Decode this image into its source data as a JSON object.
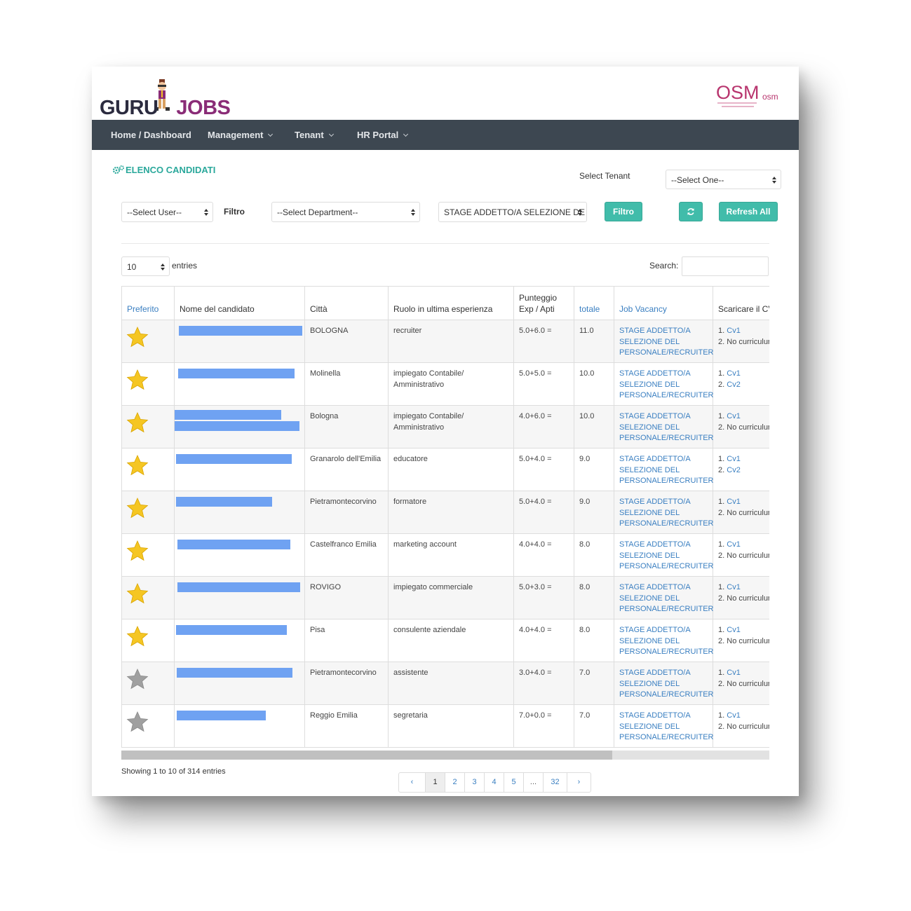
{
  "brand": {
    "logo_left_part": "GURU",
    "logo_right_part": "JOBS",
    "partner_logo": "OSM",
    "partner_logo_small": "osm"
  },
  "nav": {
    "items": [
      {
        "label": "Home / Dashboard",
        "has_caret": false
      },
      {
        "label": "Management",
        "has_caret": true
      },
      {
        "label": "Tenant",
        "has_caret": true
      },
      {
        "label": "HR Portal",
        "has_caret": true
      }
    ]
  },
  "page": {
    "title": "ELENCO CANDIDATI",
    "title_icon": "gears-icon"
  },
  "tenant": {
    "label": "Select Tenant",
    "value": "--Select One--"
  },
  "filters": {
    "user_select": "--Select User--",
    "filter_label": "Filtro",
    "department_select": "--Select Department--",
    "vacancy_select": "STAGE ADDETTO/A SELEZIONE DE",
    "filter_button": "Filtro",
    "reload_icon": "refresh-icon",
    "refresh_all_button": "Refresh All"
  },
  "length": {
    "value": "10",
    "suffix": "entries"
  },
  "search": {
    "label": "Search:",
    "value": ""
  },
  "colors": {
    "accent": "#41bcaa",
    "nav": "#3d4751",
    "link": "#3a7fc1",
    "title": "#2aa89b",
    "star_on": "#f5c623",
    "star_off": "#a0a0a0"
  },
  "table": {
    "headers": {
      "preferito": "Preferito",
      "nome": "Nome del candidato",
      "citta": "Città",
      "ruolo": "Ruolo in ultima esperienza",
      "punteggio_1": "Punteggio",
      "punteggio_2": "Exp / Apti",
      "totale": "totale",
      "job": "Job Vacancy",
      "scaricare": "Scaricare il CV"
    },
    "rows": [
      {
        "favorite": true,
        "city": "BOLOGNA",
        "role": "recruiter",
        "score": "5.0+6.0 =",
        "total": "11.0",
        "job_1": "STAGE ADDETTO/A",
        "job_2": "SELEZIONE DEL",
        "job_3": "PERSONALE/RECRUITER",
        "cv_1_num": "1.",
        "cv_1": "Cv1",
        "cv_2_num": "2.",
        "cv_2": "",
        "cv_2_text": "No curriculum"
      },
      {
        "favorite": true,
        "city": "Molinella",
        "role": "impiegato Contabile/ Amministrativo",
        "score": "5.0+5.0 =",
        "total": "10.0",
        "job_1": "STAGE ADDETTO/A",
        "job_2": "SELEZIONE DEL",
        "job_3": "PERSONALE/RECRUITER",
        "cv_1_num": "1.",
        "cv_1": "Cv1",
        "cv_2_num": "2.",
        "cv_2": "Cv2",
        "cv_2_text": ""
      },
      {
        "favorite": true,
        "city": "Bologna",
        "role": "impiegato Contabile/ Amministrativo",
        "score": "4.0+6.0 =",
        "total": "10.0",
        "job_1": "STAGE ADDETTO/A",
        "job_2": "SELEZIONE DEL",
        "job_3": "PERSONALE/RECRUITER",
        "cv_1_num": "1.",
        "cv_1": "Cv1",
        "cv_2_num": "2.",
        "cv_2": "",
        "cv_2_text": "No curriculum"
      },
      {
        "favorite": true,
        "city": "Granarolo dell'Emilia",
        "role": "educatore",
        "score": "5.0+4.0 =",
        "total": "9.0",
        "job_1": "STAGE ADDETTO/A",
        "job_2": "SELEZIONE DEL",
        "job_3": "PERSONALE/RECRUITER",
        "cv_1_num": "1.",
        "cv_1": "Cv1",
        "cv_2_num": "2.",
        "cv_2": "Cv2",
        "cv_2_text": ""
      },
      {
        "favorite": true,
        "city": "Pietramontecorvino",
        "role": "formatore",
        "score": "5.0+4.0 =",
        "total": "9.0",
        "job_1": "STAGE ADDETTO/A",
        "job_2": "SELEZIONE DEL",
        "job_3": "PERSONALE/RECRUITER",
        "cv_1_num": "1.",
        "cv_1": "Cv1",
        "cv_2_num": "2.",
        "cv_2": "",
        "cv_2_text": "No curriculum"
      },
      {
        "favorite": true,
        "city": "Castelfranco Emilia",
        "role": "marketing account",
        "score": "4.0+4.0 =",
        "total": "8.0",
        "job_1": "STAGE ADDETTO/A",
        "job_2": "SELEZIONE DEL",
        "job_3": "PERSONALE/RECRUITER",
        "cv_1_num": "1.",
        "cv_1": "Cv1",
        "cv_2_num": "2.",
        "cv_2": "",
        "cv_2_text": "No curriculum"
      },
      {
        "favorite": true,
        "city": "ROVIGO",
        "role": "impiegato commerciale",
        "score": "5.0+3.0 =",
        "total": "8.0",
        "job_1": "STAGE ADDETTO/A",
        "job_2": "SELEZIONE DEL",
        "job_3": "PERSONALE/RECRUITER",
        "cv_1_num": "1.",
        "cv_1": "Cv1",
        "cv_2_num": "2.",
        "cv_2": "",
        "cv_2_text": "No curriculum"
      },
      {
        "favorite": true,
        "city": "Pisa",
        "role": "consulente aziendale",
        "score": "4.0+4.0 =",
        "total": "8.0",
        "job_1": "STAGE ADDETTO/A",
        "job_2": "SELEZIONE DEL",
        "job_3": "PERSONALE/RECRUITER",
        "cv_1_num": "1.",
        "cv_1": "Cv1",
        "cv_2_num": "2.",
        "cv_2": "",
        "cv_2_text": "No curriculum"
      },
      {
        "favorite": false,
        "city": "Pietramontecorvino",
        "role": "assistente",
        "score": "3.0+4.0 =",
        "total": "7.0",
        "job_1": "STAGE ADDETTO/A",
        "job_2": "SELEZIONE DEL",
        "job_3": "PERSONALE/RECRUITER",
        "cv_1_num": "1.",
        "cv_1": "Cv1",
        "cv_2_num": "2.",
        "cv_2": "",
        "cv_2_text": "No curriculum"
      },
      {
        "favorite": false,
        "city": "Reggio Emilia",
        "role": "segretaria",
        "score": "7.0+0.0 =",
        "total": "7.0",
        "job_1": "STAGE ADDETTO/A",
        "job_2": "SELEZIONE DEL",
        "job_3": "PERSONALE/RECRUITER",
        "cv_1_num": "1.",
        "cv_1": "Cv1",
        "cv_2_num": "2.",
        "cv_2": "",
        "cv_2_text": "No curriculum"
      }
    ]
  },
  "info": "Showing 1 to 10 of 314 entries",
  "pagination": {
    "prev": "‹",
    "pages": [
      "1",
      "2",
      "3",
      "4",
      "5",
      "...",
      "32"
    ],
    "active": "1",
    "next": "›"
  }
}
